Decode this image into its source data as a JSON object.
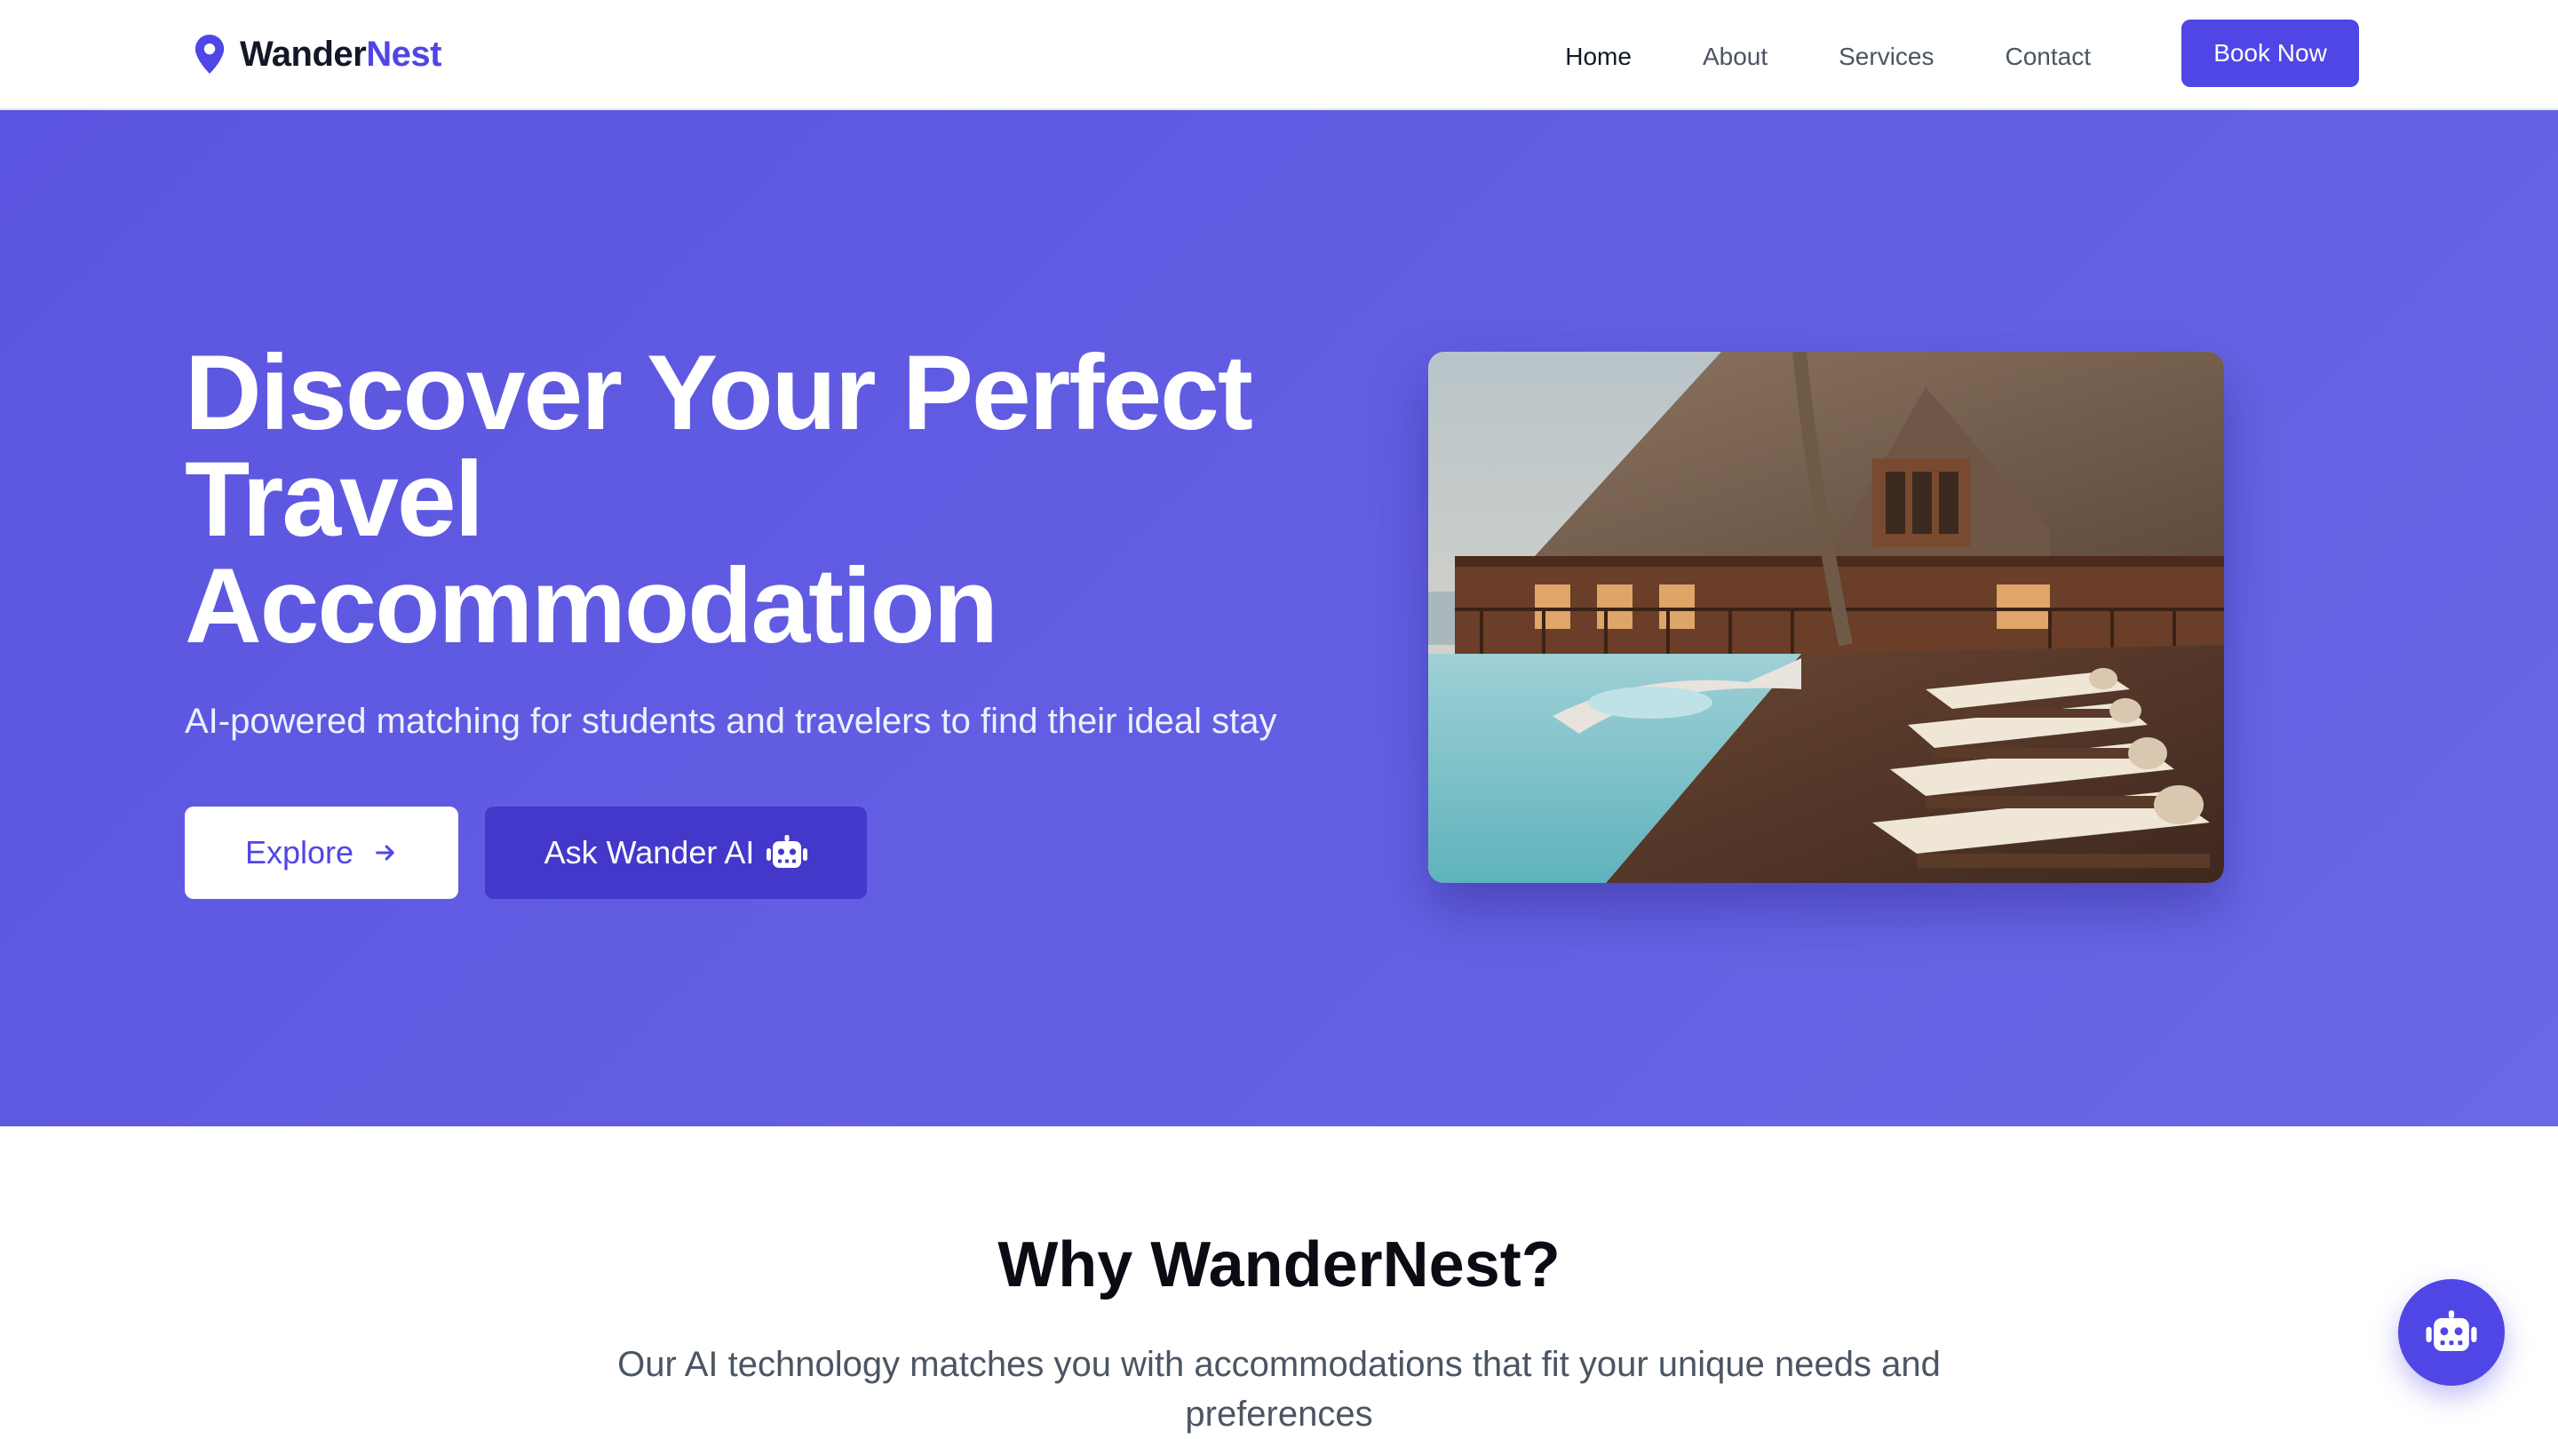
{
  "navbar": {
    "brand_part1": "Wander",
    "brand_part2": "Nest",
    "brand_icon": "map-pin-icon",
    "links": [
      {
        "label": "Home",
        "active": true
      },
      {
        "label": "About",
        "active": false
      },
      {
        "label": "Services",
        "active": false
      },
      {
        "label": "Contact",
        "active": false
      }
    ],
    "cta_label": "Book Now"
  },
  "hero": {
    "title_lines": [
      "Discover Your Perfect",
      "Travel",
      "Accommodation"
    ],
    "subtitle": "AI-powered matching for students and travelers to find their ideal stay",
    "explore_label": "Explore",
    "explore_icon": "arrow-right-icon",
    "ask_label": "Ask Wander AI",
    "ask_icon": "robot-icon",
    "image_subject": "resort-pool-with-sun-loungers"
  },
  "features": {
    "title": "Why WanderNest?",
    "subtitle": "Our AI technology matches you with accommodations that fit your unique needs and preferences"
  },
  "chat_fab": {
    "icon": "robot-icon"
  },
  "colors": {
    "brand": "#4f46e5",
    "brand_dark": "#4338ca",
    "hero_bg": "#6363e2",
    "text_dark": "#111827",
    "text_muted": "#4b5563"
  }
}
